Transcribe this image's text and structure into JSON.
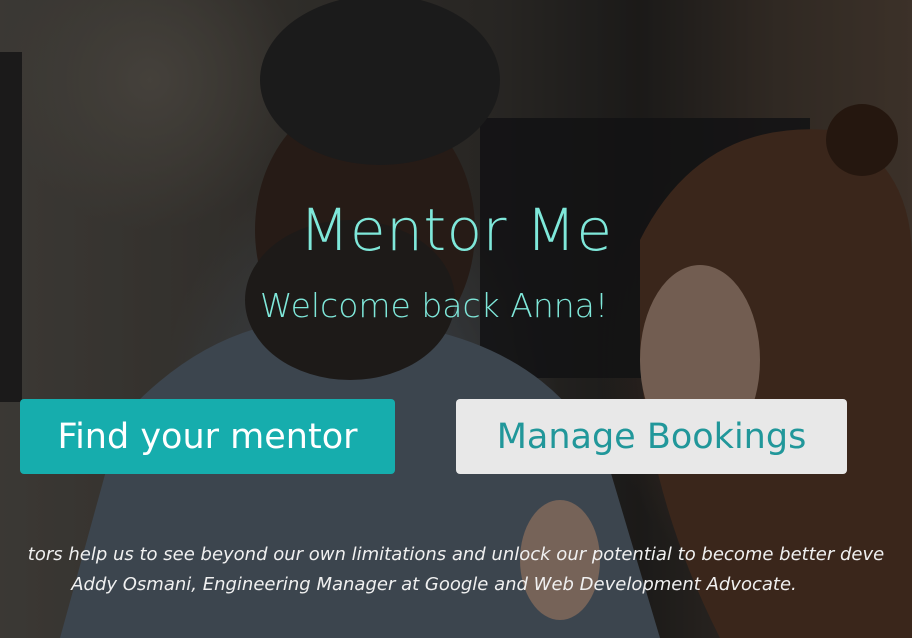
{
  "hero": {
    "title": "Mentor Me",
    "welcome": "Welcome back Anna!",
    "background_image": "mentor-and-mentee-photo",
    "accent_color": "#7fe8da"
  },
  "actions": {
    "find_mentor_label": "Find your mentor",
    "find_mentor_color": "#16adad",
    "manage_bookings_label": "Manage Bookings",
    "manage_bookings_color": "#e8e8e8"
  },
  "quote": {
    "text": "tors help us to see beyond our own limitations and unlock our potential to become better deve",
    "author": "Addy Osmani, Engineering Manager at Google and Web Development Advocate."
  }
}
